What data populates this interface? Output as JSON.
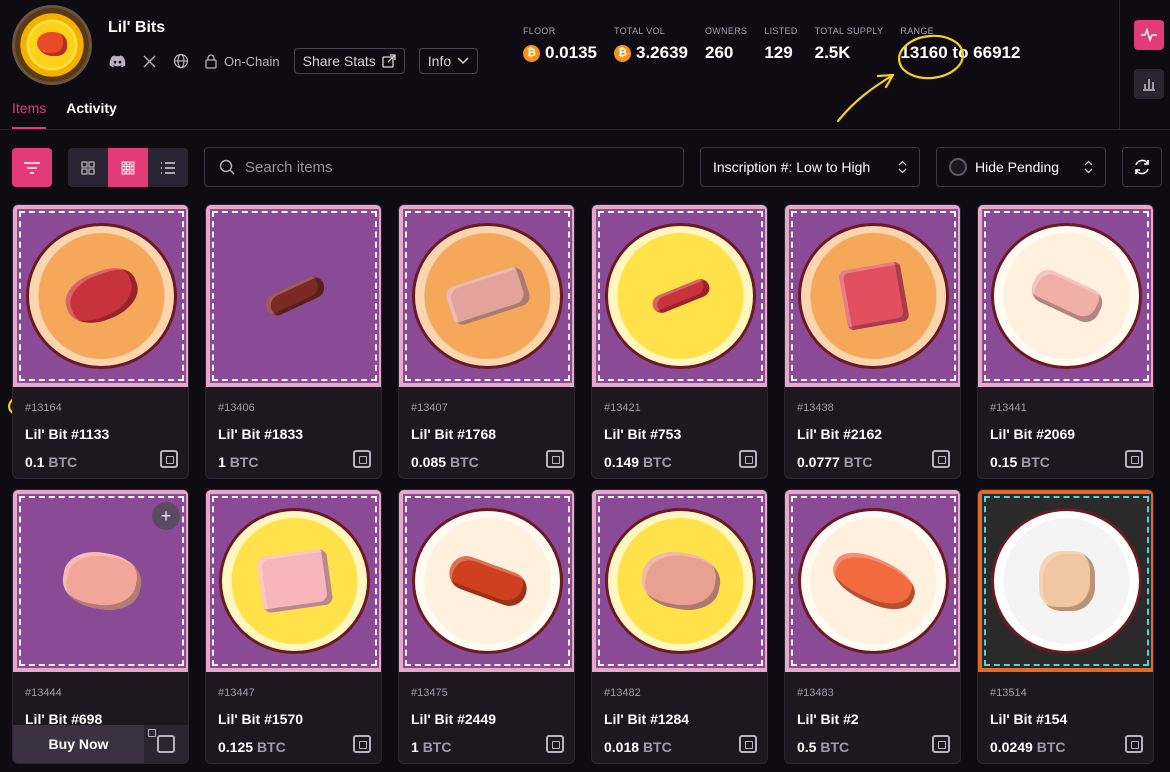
{
  "collection": {
    "name": "Lil' Bits",
    "onchain_label": "On-Chain",
    "share_label": "Share Stats",
    "info_label": "Info"
  },
  "stats": [
    {
      "label": "FLOOR",
      "value": "0.0135",
      "btc": true
    },
    {
      "label": "TOTAL VOL",
      "value": "3.2639",
      "btc": true
    },
    {
      "label": "OWNERS",
      "value": "260",
      "btc": false
    },
    {
      "label": "LISTED",
      "value": "129",
      "btc": false
    },
    {
      "label": "TOTAL SUPPLY",
      "value": "2.5K",
      "btc": false
    },
    {
      "label": "RANGE",
      "value": "13160 to 66912",
      "btc": false
    }
  ],
  "tabs": [
    "Items",
    "Activity"
  ],
  "toolbar": {
    "search_placeholder": "Search items",
    "sort_value": "Inscription #: Low to High",
    "pending_value": "Hide Pending"
  },
  "colors": {
    "accent": "#e33b7a",
    "btc": "#f7931a",
    "annotation": "#f5d020"
  },
  "items": [
    {
      "inscription": "#13164",
      "title": "Lil' Bit #1133",
      "price": "0.1",
      "unit": "BTC"
    },
    {
      "inscription": "#13406",
      "title": "Lil' Bit #1833",
      "price": "1",
      "unit": "BTC"
    },
    {
      "inscription": "#13407",
      "title": "Lil' Bit #1768",
      "price": "0.085",
      "unit": "BTC"
    },
    {
      "inscription": "#13421",
      "title": "Lil' Bit #753",
      "price": "0.149",
      "unit": "BTC"
    },
    {
      "inscription": "#13438",
      "title": "Lil' Bit #2162",
      "price": "0.0777",
      "unit": "BTC"
    },
    {
      "inscription": "#13441",
      "title": "Lil' Bit #2069",
      "price": "0.15",
      "unit": "BTC"
    },
    {
      "inscription": "#13444",
      "title": "Lil' Bit #698",
      "buy_label": "Buy Now"
    },
    {
      "inscription": "#13447",
      "title": "Lil' Bit #1570",
      "price": "0.125",
      "unit": "BTC"
    },
    {
      "inscription": "#13475",
      "title": "Lil' Bit #2449",
      "price": "1",
      "unit": "BTC"
    },
    {
      "inscription": "#13482",
      "title": "Lil' Bit #1284",
      "price": "0.018",
      "unit": "BTC"
    },
    {
      "inscription": "#13483",
      "title": "Lil' Bit #2",
      "price": "0.5",
      "unit": "BTC"
    },
    {
      "inscription": "#13514",
      "title": "Lil' Bit #154",
      "price": "0.0249",
      "unit": "BTC"
    }
  ]
}
